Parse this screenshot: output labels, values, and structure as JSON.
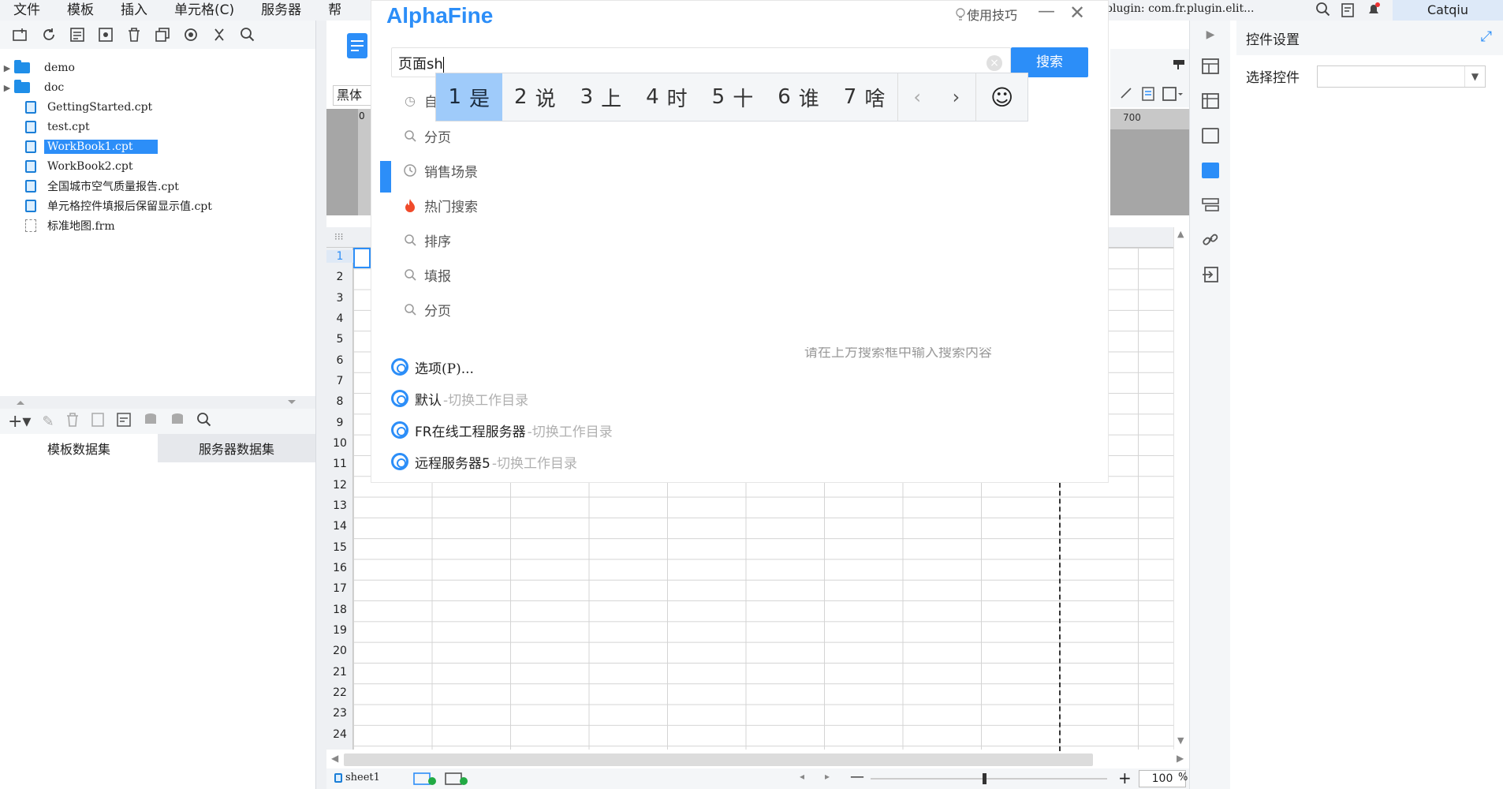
{
  "menu": [
    "文件",
    "模板",
    "插入",
    "单元格(C)",
    "服务器",
    "帮"
  ],
  "toolbar_icons": [
    "new-folder-icon",
    "refresh-icon",
    "template-icon",
    "settings-icon",
    "delete-icon",
    "copy-icon",
    "locate-icon",
    "collapse-icon",
    "search-icon"
  ],
  "tree": [
    {
      "label": "demo",
      "type": "folder",
      "expandable": true
    },
    {
      "label": "doc",
      "type": "folder",
      "expandable": true
    },
    {
      "label": "GettingStarted.cpt",
      "type": "cpt"
    },
    {
      "label": "test.cpt",
      "type": "cpt"
    },
    {
      "label": "WorkBook1.cpt",
      "type": "cpt",
      "selected": true
    },
    {
      "label": "WorkBook2.cpt",
      "type": "cpt"
    },
    {
      "label": "全国城市空气质量报告.cpt",
      "type": "cpt"
    },
    {
      "label": "单元格控件填报后保留显示值.cpt",
      "type": "cpt"
    },
    {
      "label": "标准地图.frm",
      "type": "frm"
    }
  ],
  "dataset_tabs": [
    "模板数据集",
    "服务器数据集"
  ],
  "editor": {
    "font": "黑体",
    "ruler_value": "700",
    "ruler_zero": "0",
    "rows": [
      "1",
      "2",
      "3",
      "4",
      "5",
      "6",
      "7",
      "8",
      "9",
      "10",
      "11",
      "12",
      "13",
      "14",
      "15",
      "16",
      "17",
      "18",
      "19",
      "20",
      "21",
      "22",
      "23",
      "24"
    ],
    "sheet_tab": "sheet1",
    "zoom": "100",
    "zoom_unit": "%",
    "zoom_minus": "—",
    "zoom_plus": "+"
  },
  "topbar": {
    "plugin_text": "plugin: com.fr.plugin.elit...",
    "user": "Catqiu"
  },
  "right_panel": {
    "title": "控件设置",
    "select_label": "选择控件",
    "select_value": ""
  },
  "alphafine": {
    "logo": "AlphaFine",
    "tips": "使用技巧",
    "minimize": "—",
    "close": "✕",
    "search_value": "页面sh",
    "search_button": "搜索",
    "ime": {
      "candidates": [
        {
          "n": "1",
          "c": "是"
        },
        {
          "n": "2",
          "c": "说"
        },
        {
          "n": "3",
          "c": "上"
        },
        {
          "n": "4",
          "c": "时"
        },
        {
          "n": "5",
          "c": "十"
        },
        {
          "n": "6",
          "c": "谁"
        },
        {
          "n": "7",
          "c": "啥"
        }
      ],
      "prev": "‹",
      "next": "›",
      "emoji": "☺"
    },
    "history_partial": "自",
    "history": [
      {
        "label": "分页",
        "icon": "search-icon"
      },
      {
        "label": "销售场景",
        "icon": "clock-icon"
      },
      {
        "label": "热门搜索",
        "icon": "fire-icon"
      },
      {
        "label": "排序",
        "icon": "search-icon"
      },
      {
        "label": "填报",
        "icon": "search-icon"
      },
      {
        "label": "分页",
        "icon": "search-icon"
      }
    ],
    "actions": [
      {
        "label": "选项(P)...",
        "sub": ""
      },
      {
        "label": "默认",
        "sub": "-切换工作目录"
      },
      {
        "label": "FR在线工程服务器",
        "sub": "-切换工作目录"
      },
      {
        "label": "远程服务器5",
        "sub": "-切换工作目录"
      }
    ],
    "faint_text": "请在上方搜索框中输入搜索内容"
  },
  "colors": {
    "accent": "#2c8ef8",
    "ime_selected": "#9fcbfa",
    "hot": "#f04a2a"
  }
}
